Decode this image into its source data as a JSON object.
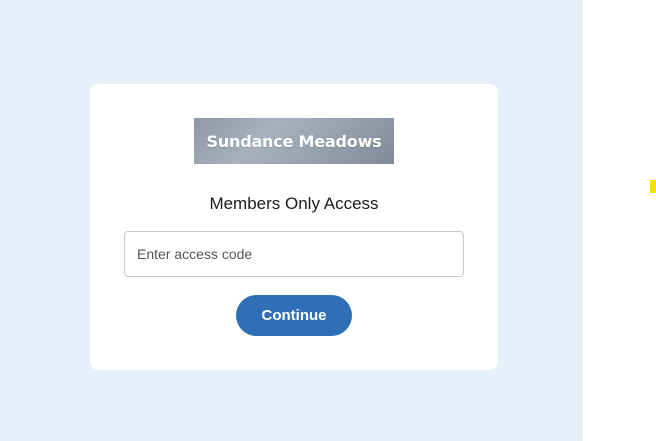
{
  "logo": {
    "text": "Sundance Meadows"
  },
  "form": {
    "heading": "Members Only Access",
    "code_placeholder": "Enter access code",
    "code_value": "",
    "continue_label": "Continue"
  },
  "colors": {
    "page_background": "#e6f0fb",
    "card_background": "#ffffff",
    "button_background": "#2f6fb6",
    "accent_mark": "#f2e200"
  }
}
